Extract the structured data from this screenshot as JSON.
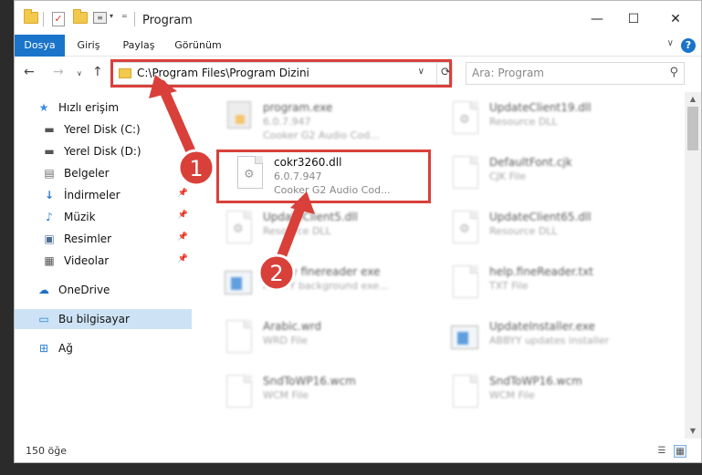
{
  "window": {
    "title": "Program",
    "controls": {
      "minimize": "—",
      "maximize": "☐",
      "close": "✕"
    }
  },
  "ribbon": {
    "tabs": [
      {
        "label": "Dosya",
        "active": true
      },
      {
        "label": "Giriş"
      },
      {
        "label": "Paylaş"
      },
      {
        "label": "Görünüm"
      }
    ],
    "help": "?"
  },
  "address": {
    "path": "C:\\Program Files\\Program Dizini",
    "search_placeholder": "Ara: Program"
  },
  "sidebar": {
    "items": [
      {
        "label": "Hızlı erişim",
        "icon": "star-icon"
      },
      {
        "label": "Yerel Disk (C:)",
        "icon": "drive-icon"
      },
      {
        "label": "Yerel Disk (D:)",
        "icon": "drive-icon"
      },
      {
        "label": "Belgeler",
        "icon": "documents-icon",
        "pinned": true
      },
      {
        "label": "İndirmeler",
        "icon": "download-icon",
        "pinned": true
      },
      {
        "label": "Müzik",
        "icon": "music-icon",
        "pinned": true
      },
      {
        "label": "Resimler",
        "icon": "pictures-icon",
        "pinned": true
      },
      {
        "label": "Videolar",
        "icon": "video-icon",
        "pinned": true
      },
      {
        "label": "OneDrive",
        "icon": "cloud-icon"
      },
      {
        "label": "Bu bilgisayar",
        "icon": "computer-icon",
        "selected": true
      },
      {
        "label": "Ağ",
        "icon": "network-icon"
      }
    ]
  },
  "files": [
    {
      "name": "program.exe",
      "line2": "6.0.7.947",
      "line3": "Cooker G2 Audio Cod...",
      "icon": "exe",
      "blur": true
    },
    {
      "name": "UpdateClient19.dll",
      "line2": "Resource DLL",
      "icon": "dll",
      "blur": true
    },
    {
      "name": "cokr3260.dll",
      "line2": "6.0.7.947",
      "line3": "Cooker G2 Audio Cod...",
      "icon": "dll",
      "highlight": true
    },
    {
      "name": "DefaultFont.cjk",
      "line2": "CJK File",
      "icon": "doc",
      "blur": true
    },
    {
      "name": "UpdateClient5.dll",
      "line2": "Resource DLL",
      "icon": "dll",
      "blur": true
    },
    {
      "name": "UpdateClient65.dll",
      "line2": "Resource DLL",
      "icon": "dll",
      "blur": true
    },
    {
      "name": "Abbyy finereader exe",
      "line2": "ABBYY background exe...",
      "icon": "app",
      "blur": true
    },
    {
      "name": "help.fineReader.txt",
      "line2": "TXT File",
      "icon": "doc",
      "blur": true
    },
    {
      "name": "Arabic.wrd",
      "line2": "WRD File",
      "icon": "doc",
      "blur": true
    },
    {
      "name": "UpdateInstaller.exe",
      "line2": "ABBYY updates installer",
      "icon": "app",
      "blur": true
    },
    {
      "name": "SndToWP16.wcm",
      "line2": "WCM File",
      "icon": "doc",
      "blur": true
    },
    {
      "name": "SndToWP16.wcm",
      "line2": "WCM File",
      "icon": "doc",
      "blur": true
    }
  ],
  "status": {
    "count": "150 öğe"
  },
  "annotations": {
    "marker1": "1",
    "marker2": "2",
    "color": "#d9403a"
  }
}
